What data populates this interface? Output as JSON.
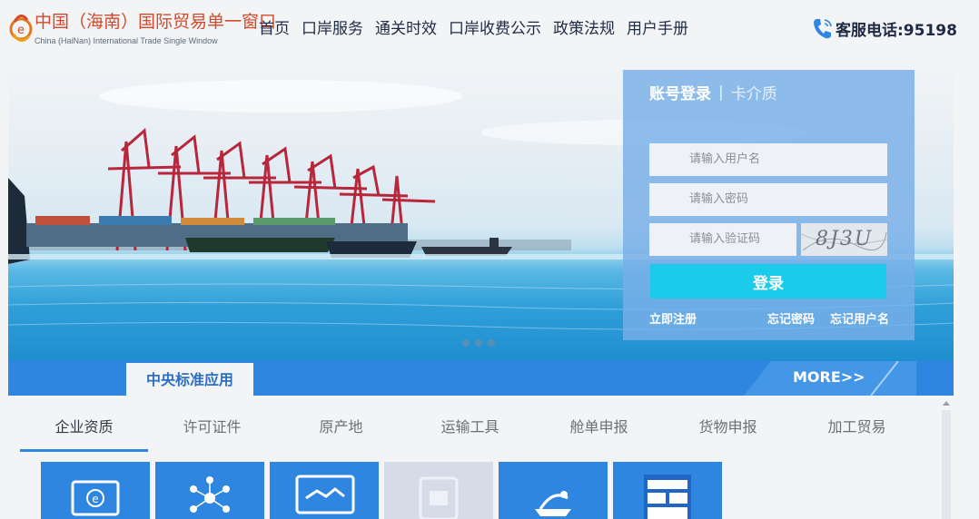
{
  "header": {
    "logo_cn": "中国（海南）国际贸易单一窗口",
    "logo_en": "China (HaiNan) International Trade Single Window",
    "nav": [
      "首页",
      "口岸服务",
      "通关时效",
      "口岸收费公示",
      "政策法规",
      "用户手册"
    ],
    "hotline": "客服电话:95198"
  },
  "login": {
    "tab_account": "账号登录",
    "tab_separator": "|",
    "tab_card": "卡介质",
    "username_placeholder": "请输入用户名",
    "password_placeholder": "请输入密码",
    "captcha_placeholder": "请输入验证码",
    "captcha_text": "8J3U",
    "submit": "登录",
    "register": "立即注册",
    "forgot_password": "忘记密码",
    "forgot_username": "忘记用户名"
  },
  "section": {
    "tab": "中央标准应用",
    "more": "MORE>>"
  },
  "categories": {
    "items": [
      "企业资质",
      "许可证件",
      "原产地",
      "运输工具",
      "舱单申报",
      "货物申报",
      "加工贸易"
    ],
    "active": "企业资质"
  },
  "tiles": [
    {
      "icon": "enterprise-monitor-icon"
    },
    {
      "icon": "network-people-icon"
    },
    {
      "icon": "handshake-icon"
    },
    {
      "icon": "document-icon",
      "disabled": true
    },
    {
      "icon": "ship-icon"
    },
    {
      "icon": "transport-icon"
    }
  ],
  "colors": {
    "primary": "#2f86e0",
    "login_button": "#1ccbea",
    "logo_red": "#d24a2a",
    "login_panel": "#78afe8"
  }
}
